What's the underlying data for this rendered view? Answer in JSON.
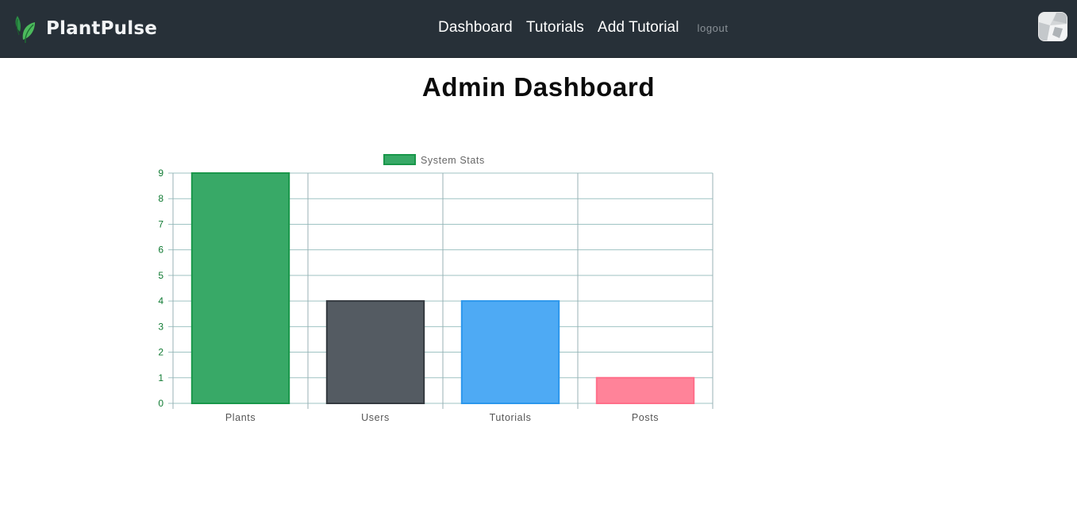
{
  "app": {
    "name": "PlantPulse"
  },
  "nav": {
    "links": [
      {
        "label": "Dashboard"
      },
      {
        "label": "Tutorials"
      },
      {
        "label": "Add Tutorial"
      }
    ],
    "logout": "logout"
  },
  "page": {
    "title": "Admin Dashboard"
  },
  "colors": {
    "navbar": "#273038",
    "grid": "#9fc3c3",
    "tick": "#0f7a32"
  },
  "chart_data": {
    "type": "bar",
    "categories": [
      "Plants",
      "Users",
      "Tutorials",
      "Posts"
    ],
    "series": [
      {
        "name": "System Stats",
        "values": [
          9,
          4,
          4,
          1
        ]
      }
    ],
    "bar_colors": [
      "#38a967",
      "#545b62",
      "#4eaaf4",
      "#ff8399"
    ],
    "bar_border_colors": [
      "#19974a",
      "#33393f",
      "#2c97ec",
      "#ff6f8a"
    ],
    "ylim": [
      0,
      9
    ],
    "yticks": [
      0,
      1,
      2,
      3,
      4,
      5,
      6,
      7,
      8,
      9
    ],
    "grid": true,
    "legend": "top-center",
    "title": "",
    "xlabel": "",
    "ylabel": ""
  }
}
